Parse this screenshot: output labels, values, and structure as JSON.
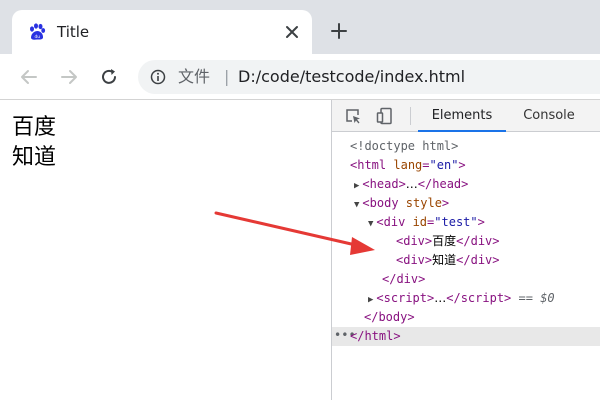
{
  "browser": {
    "tab": {
      "title": "Title",
      "favicon": "baidu-paw-icon"
    },
    "toolbar": {
      "site_info_label": "文件",
      "separator": "|",
      "url": "D:/code/testcode/index.html"
    }
  },
  "page": {
    "lines": [
      "百度",
      "知道"
    ]
  },
  "devtools": {
    "tabs": [
      "Elements",
      "Console"
    ],
    "active_tab": "Elements",
    "dom": {
      "doctype": "<!doctype html>",
      "html_open_tag": "html",
      "html_lang_attr": "lang",
      "html_lang_val": "\"en\"",
      "head_tag": "head",
      "head_ellipsis": "…",
      "body_tag": "body",
      "body_attr": "style",
      "div_tag": "div",
      "div_id_attr": "id",
      "div_id_val": "\"test\"",
      "child1_text": "百度",
      "child2_text": "知道",
      "script_tag": "script",
      "script_ellipsis": "…",
      "selected_marker": "== $0",
      "gutter_dots": "•••"
    }
  },
  "colors": {
    "tab_strip": "#dee1e6",
    "accent": "#1a73e8",
    "arrow": "#e53935",
    "tag": "#881280",
    "attr_name": "#994500",
    "attr_value": "#1a1aa6"
  }
}
